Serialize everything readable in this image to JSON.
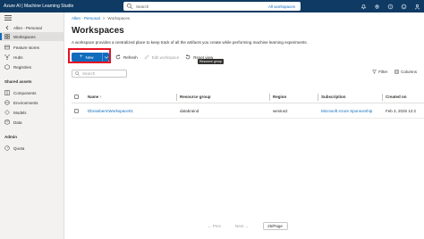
{
  "topbar": {
    "app_title": "Azure AI | Machine Learning Studio",
    "search_placeholder": "Search",
    "search_scope": "All workspaces"
  },
  "sidebar": {
    "workspace_name": "Allen - Personal",
    "items": [
      {
        "label": "Workspaces",
        "active": true
      },
      {
        "label": "Feature stores"
      },
      {
        "label": "Hubs"
      },
      {
        "label": "Registries"
      }
    ],
    "shared_header": "Shared assets",
    "shared_items": [
      {
        "label": "Components"
      },
      {
        "label": "Environments"
      },
      {
        "label": "Models"
      },
      {
        "label": "Data"
      }
    ],
    "admin_header": "Admin",
    "admin_items": [
      {
        "label": "Quota"
      }
    ]
  },
  "breadcrumb": {
    "root": "Allen - Personal",
    "current": "Workspaces"
  },
  "page": {
    "title": "Workspaces",
    "description": "A workspace provides a centralized place to keep track of all the artifacts you create while performing machine learning experiments."
  },
  "toolbar": {
    "new_label": "New",
    "refresh_label": "Refresh",
    "edit_label": "Edit workspace",
    "reset_label": "Reset view",
    "tooltip": "Resource group"
  },
  "filter": {
    "placeholder": "Search",
    "filter_label": "Filter",
    "columns_label": "Columns"
  },
  "table": {
    "headers": [
      "Name",
      "Resource group",
      "Region",
      "Subscription",
      "Created on"
    ],
    "sort_indicator": "↑",
    "rows": [
      {
        "name": "DbrainbermWorkspace01",
        "resource_group": "databraind",
        "region": "westus2",
        "subscription": "Microsoft Azure Sponsorship",
        "created_on": "Feb 3, 2025 12:2"
      }
    ]
  },
  "pager": {
    "prev": "Prev",
    "next": "Next",
    "page_size": "25/Page"
  }
}
